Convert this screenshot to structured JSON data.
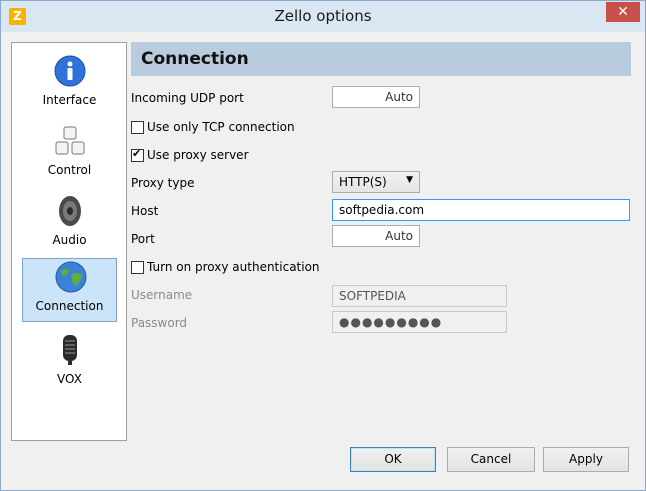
{
  "window": {
    "title": "Zello options",
    "app_icon_letter": "Z",
    "close_glyph": "✕"
  },
  "sidebar": {
    "items": [
      {
        "label": "Interface",
        "icon": "info-icon",
        "selected": false
      },
      {
        "label": "Control",
        "icon": "keys-icon",
        "selected": false
      },
      {
        "label": "Audio",
        "icon": "speaker-icon",
        "selected": false
      },
      {
        "label": "Connection",
        "icon": "globe-icon",
        "selected": true
      },
      {
        "label": "VOX",
        "icon": "microphone-icon",
        "selected": false
      }
    ]
  },
  "section": {
    "title": "Connection"
  },
  "form": {
    "udp_label": "Incoming UDP port",
    "udp_value": "Auto",
    "tcp_label": "Use only TCP connection",
    "tcp_checked": false,
    "proxy_label": "Use proxy server",
    "proxy_checked": true,
    "proxy_type_label": "Proxy type",
    "proxy_type_value": "HTTP(S)",
    "host_label": "Host",
    "host_value": "softpedia.com",
    "port_label": "Port",
    "port_value": "Auto",
    "auth_label": "Turn on proxy authentication",
    "auth_checked": false,
    "username_label": "Username",
    "username_value": "SOFTPEDIA",
    "password_label": "Password",
    "password_value": "●●●●●●●●●"
  },
  "buttons": {
    "ok": "OK",
    "cancel": "Cancel",
    "apply": "Apply"
  }
}
